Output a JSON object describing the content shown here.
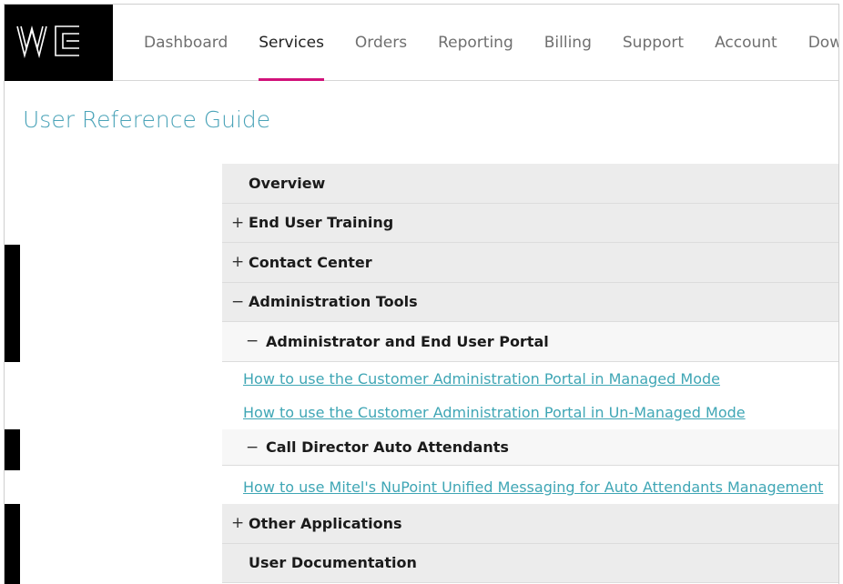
{
  "brand": {
    "logo_text": "WE"
  },
  "nav": {
    "items": [
      {
        "label": "Dashboard",
        "active": false
      },
      {
        "label": "Services",
        "active": true
      },
      {
        "label": "Orders",
        "active": false
      },
      {
        "label": "Reporting",
        "active": false
      },
      {
        "label": "Billing",
        "active": false
      },
      {
        "label": "Support",
        "active": false
      },
      {
        "label": "Account",
        "active": false
      },
      {
        "label": "Download",
        "active": false
      }
    ]
  },
  "page": {
    "title": "User Reference Guide"
  },
  "menu": {
    "overview": "Overview",
    "end_user_training": {
      "toggle": "+",
      "label": "End User Training"
    },
    "contact_center": {
      "toggle": "+",
      "label": "Contact Center"
    },
    "admin_tools": {
      "toggle": "−",
      "label": "Administration Tools"
    },
    "admin_portal": {
      "toggle": "−",
      "label": "Administrator and End User Portal"
    },
    "admin_portal_links": [
      "How to use the Customer Administration Portal in Managed Mode",
      "How to use the Customer Administration Portal in Un-Managed Mode"
    ],
    "call_director": {
      "toggle": "−",
      "label": "Call Director Auto Attendants"
    },
    "call_director_links": [
      "How to use Mitel's NuPoint Unified Messaging for Auto Attendants Management"
    ],
    "other_apps": {
      "toggle": "+",
      "label": "Other Applications"
    },
    "user_docs": "User Documentation"
  },
  "colors": {
    "accent": "#d1117a",
    "link": "#3fa6b5",
    "title": "#4aa3b8"
  }
}
